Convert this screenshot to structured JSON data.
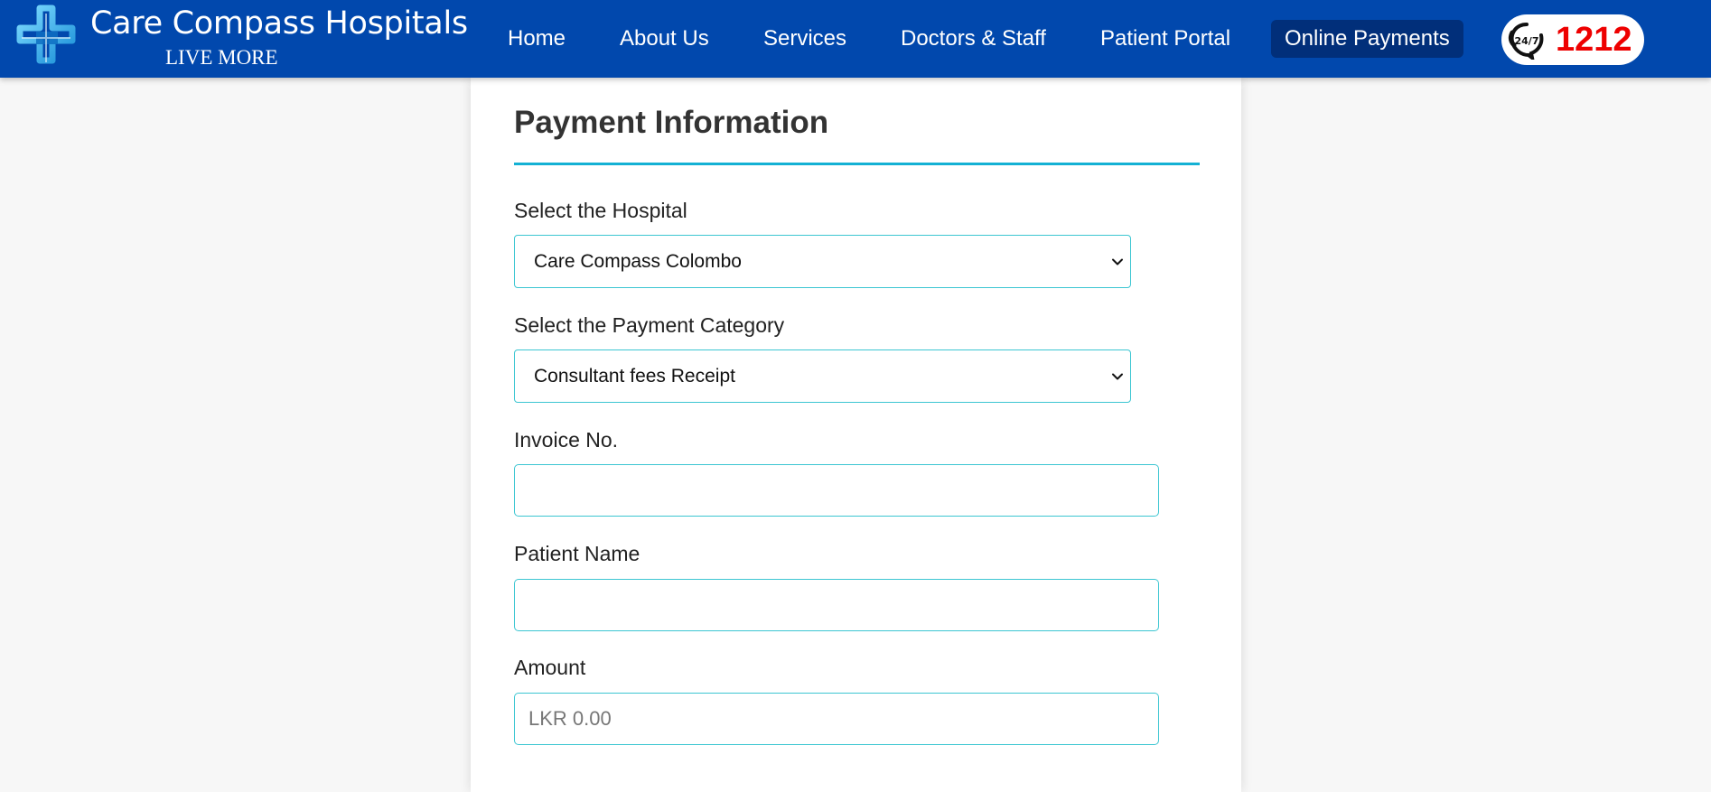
{
  "brand": {
    "name": "Care Compass Hospitals",
    "tagline": "LIVE MORE"
  },
  "nav": {
    "items": [
      {
        "label": "Home"
      },
      {
        "label": "About Us"
      },
      {
        "label": "Services"
      },
      {
        "label": "Doctors & Staff"
      },
      {
        "label": "Patient Portal"
      },
      {
        "label": "Online Payments",
        "active": true
      }
    ]
  },
  "hotline": {
    "icon": "phone-24-7-icon",
    "badge_text": "24/7",
    "number": "1212"
  },
  "colors": {
    "header_bg": "#0148ad",
    "nav_active_bg": "#012f7a",
    "accent": "#14b1d4",
    "input_border": "#3cc6d2",
    "hotline_number": "#ee0000"
  },
  "form": {
    "title": "Payment Information",
    "hospital": {
      "label": "Select the Hospital",
      "selected": "Care Compass Colombo"
    },
    "category": {
      "label": "Select the Payment Category",
      "selected": "Consultant fees Receipt"
    },
    "invoice": {
      "label": "Invoice No.",
      "value": "",
      "placeholder": ""
    },
    "patient_name": {
      "label": "Patient Name",
      "value": "",
      "placeholder": ""
    },
    "amount": {
      "label": "Amount",
      "value": "",
      "placeholder": "LKR 0.00"
    }
  }
}
